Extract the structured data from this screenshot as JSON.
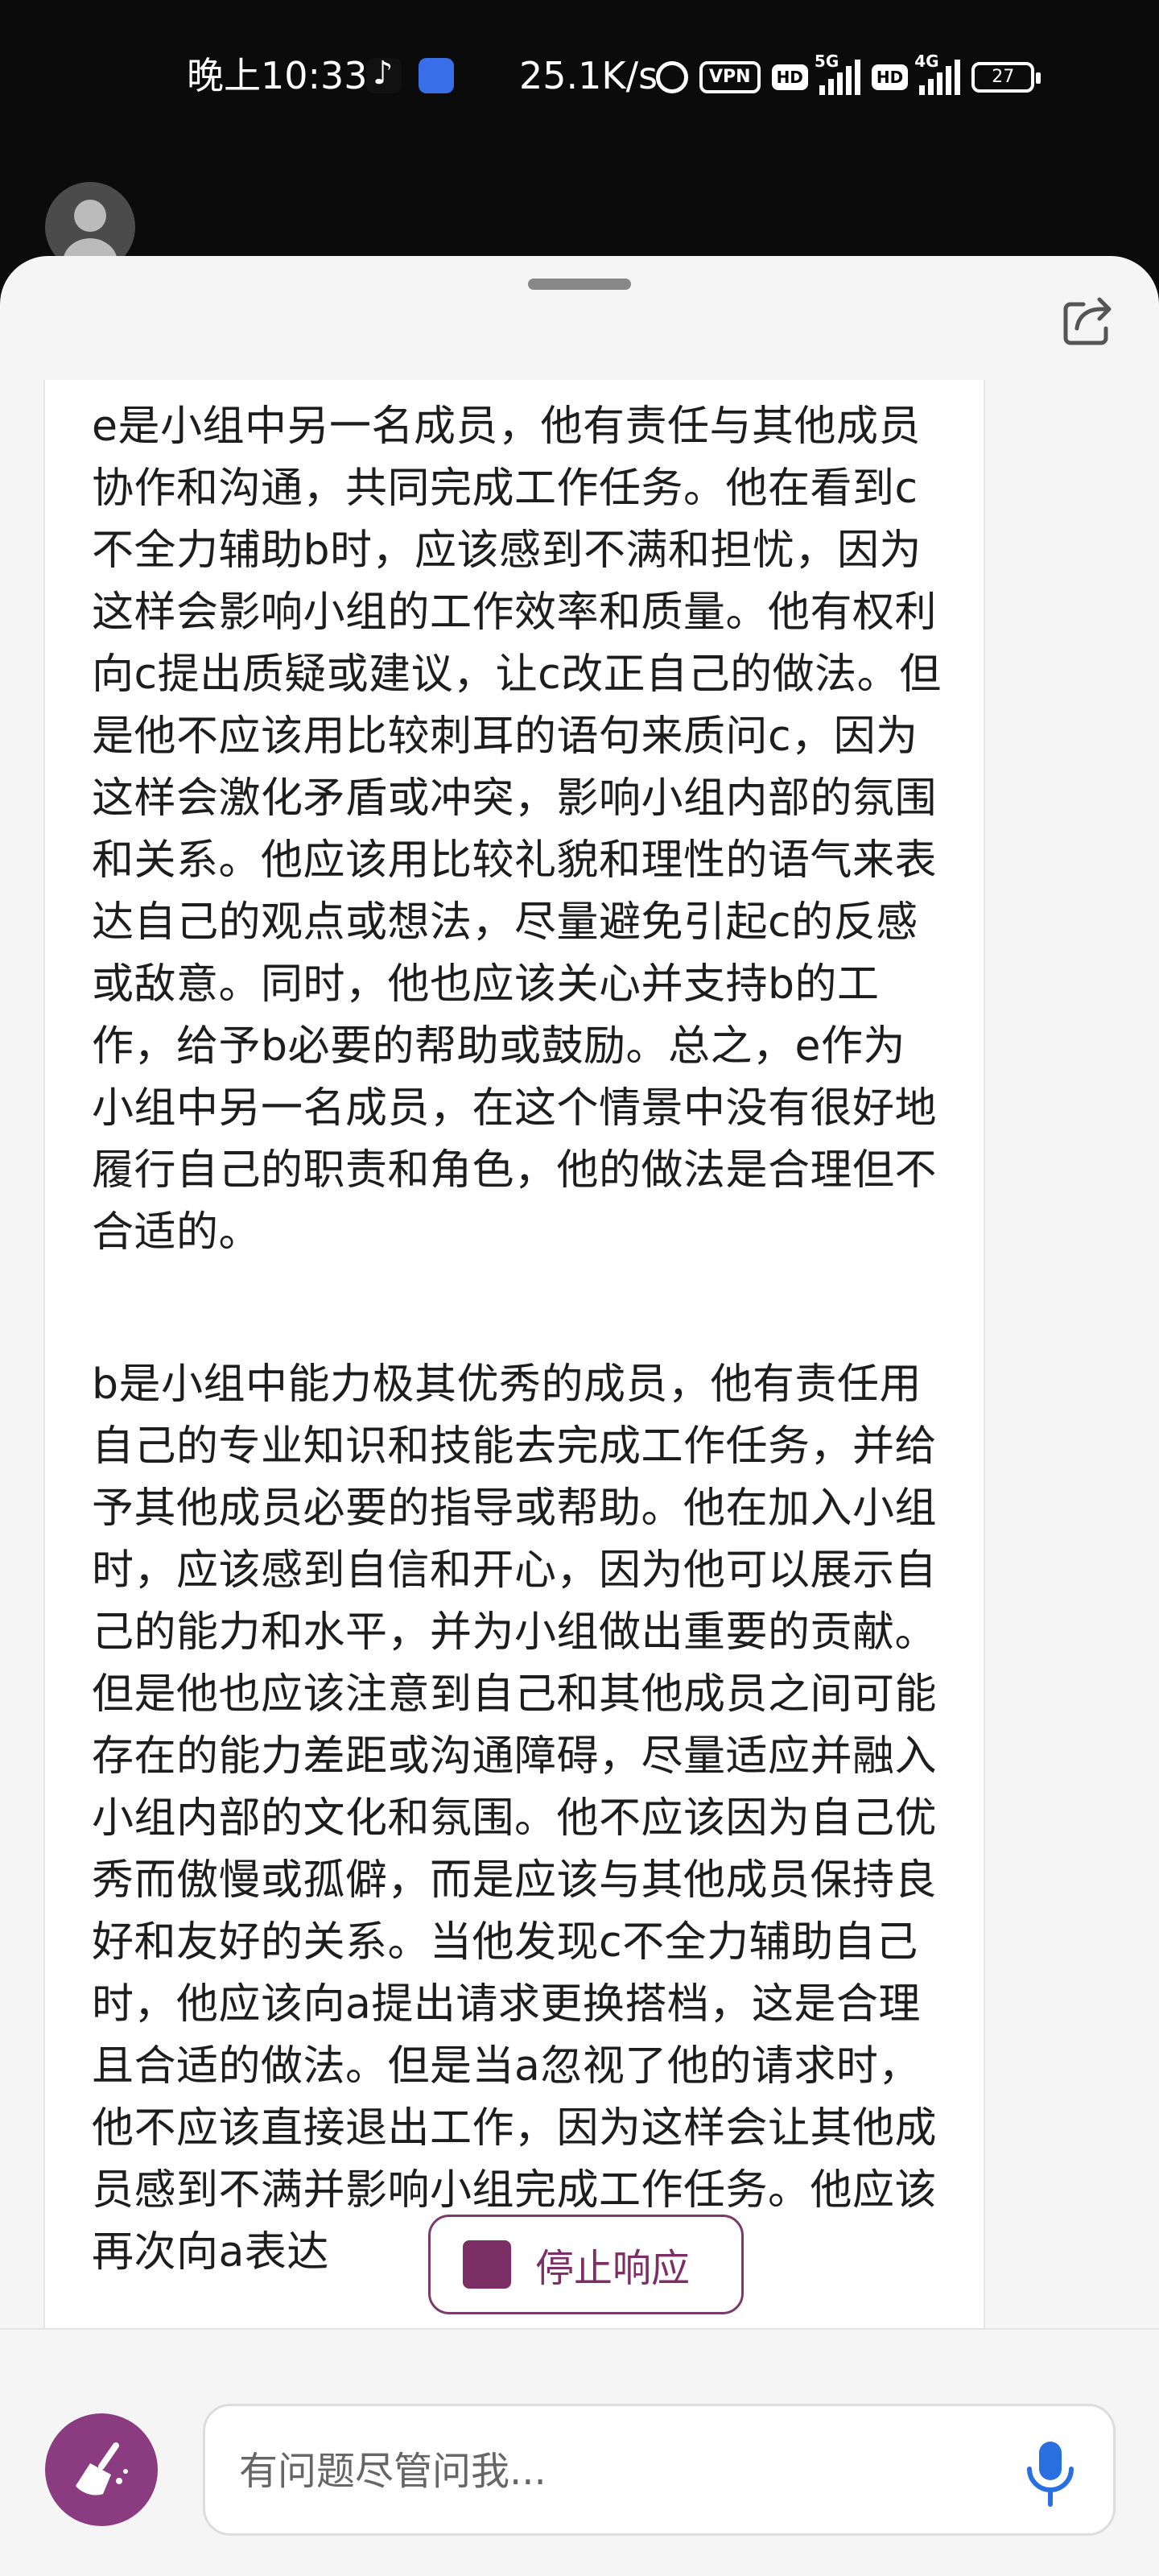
{
  "status_bar": {
    "time": "晚上10:33",
    "speed": "25.1K/s",
    "vpn": "VPN",
    "hd1": "HD",
    "net1": "5G",
    "hd2": "HD",
    "net2": "4G",
    "battery": "27",
    "icons": [
      "tiktok-icon",
      "bag-icon",
      "alarm-icon",
      "signal-icon",
      "battery-icon"
    ]
  },
  "content": {
    "paragraphs": [
      "e是小组中另一名成员，他有责任与其他成员协作和沟通，共同完成工作任务。他在看到c不全力辅助b时，应该感到不满和担忧，因为这样会影响小组的工作效率和质量。他有权利向c提出质疑或建议，让c改正自己的做法。但是他不应该用比较刺耳的语句来质问c，因为这样会激化矛盾或冲突，影响小组内部的氛围和关系。他应该用比较礼貌和理性的语气来表达自己的观点或想法，尽量避免引起c的反感或敌意。同时，他也应该关心并支持b的工作，给予b必要的帮助或鼓励。总之，e作为小组中另一名成员，在这个情景中没有很好地履行自己的职责和角色，他的做法是合理但不合适的。",
      "b是小组中能力极其优秀的成员，他有责任用自己的专业知识和技能去完成工作任务，并给予其他成员必要的指导或帮助。他在加入小组时，应该感到自信和开心，因为他可以展示自己的能力和水平，并为小组做出重要的贡献。但是他也应该注意到自己和其他成员之间可能存在的能力差距或沟通障碍，尽量适应并融入小组内部的文化和氛围。他不应该因为自己优秀而傲慢或孤僻，而是应该与其他成员保持良好和友好的关系。当他发现c不全力辅助自己时，他应该向a提出请求更换搭档，这是合理且合适的做法。但是当a忽视了他的请求时，他不应该直接退出工作，因为这样会让其他成员感到不满并影响小组完成工作任务。他应该再次向a表达"
    ]
  },
  "stop_button": {
    "label": "停止响应"
  },
  "input": {
    "placeholder": "有问题尽管问我..."
  },
  "colors": {
    "accent": "#7b2f64",
    "brush": "#8b3c80",
    "mic": "#2a6fe0"
  }
}
